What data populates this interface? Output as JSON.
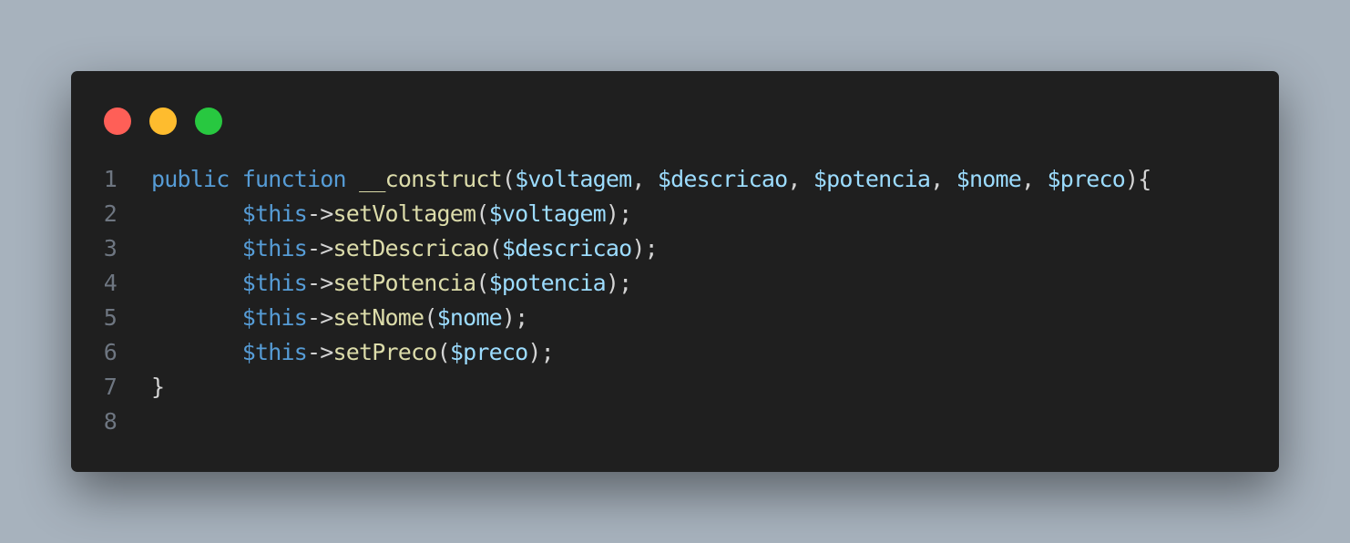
{
  "window": {
    "controls": {
      "close_color": "#ff5f57",
      "minimize_color": "#febc2e",
      "maximize_color": "#28c840"
    }
  },
  "code": {
    "language": "php",
    "lines": [
      {
        "number": "1",
        "tokens": [
          {
            "text": "public",
            "type": "kw"
          },
          {
            "text": " ",
            "type": "punc"
          },
          {
            "text": "function",
            "type": "kw"
          },
          {
            "text": " ",
            "type": "punc"
          },
          {
            "text": "__construct",
            "type": "fn"
          },
          {
            "text": "(",
            "type": "punc"
          },
          {
            "text": "$voltagem",
            "type": "var"
          },
          {
            "text": ", ",
            "type": "punc"
          },
          {
            "text": "$descricao",
            "type": "var"
          },
          {
            "text": ", ",
            "type": "punc"
          },
          {
            "text": "$potencia",
            "type": "var"
          },
          {
            "text": ", ",
            "type": "punc"
          },
          {
            "text": "$nome",
            "type": "var"
          },
          {
            "text": ", ",
            "type": "punc"
          },
          {
            "text": "$preco",
            "type": "var"
          },
          {
            "text": "){",
            "type": "punc"
          }
        ]
      },
      {
        "number": "2",
        "tokens": [
          {
            "text": "       ",
            "type": "punc"
          },
          {
            "text": "$this",
            "type": "this"
          },
          {
            "text": "->",
            "type": "op"
          },
          {
            "text": "setVoltagem",
            "type": "fn"
          },
          {
            "text": "(",
            "type": "punc"
          },
          {
            "text": "$voltagem",
            "type": "var"
          },
          {
            "text": ");",
            "type": "punc"
          }
        ]
      },
      {
        "number": "3",
        "tokens": [
          {
            "text": "       ",
            "type": "punc"
          },
          {
            "text": "$this",
            "type": "this"
          },
          {
            "text": "->",
            "type": "op"
          },
          {
            "text": "setDescricao",
            "type": "fn"
          },
          {
            "text": "(",
            "type": "punc"
          },
          {
            "text": "$descricao",
            "type": "var"
          },
          {
            "text": ");",
            "type": "punc"
          }
        ]
      },
      {
        "number": "4",
        "tokens": [
          {
            "text": "       ",
            "type": "punc"
          },
          {
            "text": "$this",
            "type": "this"
          },
          {
            "text": "->",
            "type": "op"
          },
          {
            "text": "setPotencia",
            "type": "fn"
          },
          {
            "text": "(",
            "type": "punc"
          },
          {
            "text": "$potencia",
            "type": "var"
          },
          {
            "text": ");",
            "type": "punc"
          }
        ]
      },
      {
        "number": "5",
        "tokens": [
          {
            "text": "       ",
            "type": "punc"
          },
          {
            "text": "$this",
            "type": "this"
          },
          {
            "text": "->",
            "type": "op"
          },
          {
            "text": "setNome",
            "type": "fn"
          },
          {
            "text": "(",
            "type": "punc"
          },
          {
            "text": "$nome",
            "type": "var"
          },
          {
            "text": ");",
            "type": "punc"
          }
        ]
      },
      {
        "number": "6",
        "tokens": [
          {
            "text": "       ",
            "type": "punc"
          },
          {
            "text": "$this",
            "type": "this"
          },
          {
            "text": "->",
            "type": "op"
          },
          {
            "text": "setPreco",
            "type": "fn"
          },
          {
            "text": "(",
            "type": "punc"
          },
          {
            "text": "$preco",
            "type": "var"
          },
          {
            "text": ");",
            "type": "punc"
          }
        ]
      },
      {
        "number": "7",
        "tokens": [
          {
            "text": "}",
            "type": "punc"
          }
        ]
      },
      {
        "number": "8",
        "tokens": []
      }
    ]
  }
}
